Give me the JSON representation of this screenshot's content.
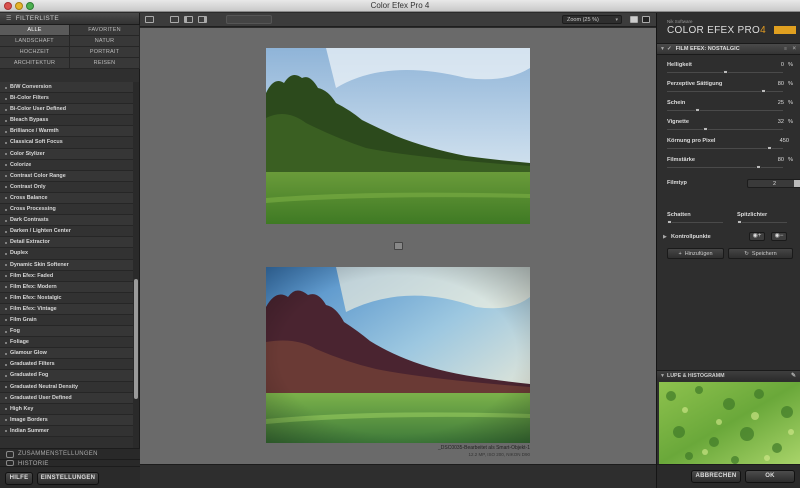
{
  "window": {
    "title": "Color Efex Pro 4"
  },
  "left_panel": {
    "header": "FILTERLISTE",
    "categories": [
      "ALLE",
      "FAVORITEN",
      "LANDSCHAFT",
      "NATUR",
      "HOCHZEIT",
      "PORTRAIT",
      "ARCHITEKTUR",
      "REISEN"
    ],
    "active_category": "ALLE",
    "filters": [
      "B/W Conversion",
      "Bi-Color Filters",
      "Bi-Color User Defined",
      "Bleach Bypass",
      "Brilliance / Warmth",
      "Classical Soft Focus",
      "Color Stylizer",
      "Colorize",
      "Contrast Color Range",
      "Contrast Only",
      "Cross Balance",
      "Cross Processing",
      "Dark Contrasts",
      "Darken / Lighten Center",
      "Detail Extractor",
      "Duplex",
      "Dynamic Skin Softener",
      "Film Efex: Faded",
      "Film Efex: Modern",
      "Film Efex: Nostalgic",
      "Film Efex: Vintage",
      "Film Grain",
      "Fog",
      "Foliage",
      "Glamour Glow",
      "Graduated Filters",
      "Graduated Fog",
      "Graduated Neutral Density",
      "Graduated User Defined",
      "High Key",
      "Image Borders",
      "Indian Summer"
    ],
    "sections": {
      "presets": "ZUSAMMENSTELLUNGEN",
      "history": "HISTORIE"
    },
    "buttons": {
      "help": "HILFE",
      "settings": "EINSTELLUNGEN"
    }
  },
  "toolbar": {
    "zoom": "Zoom (25 %)"
  },
  "canvas": {
    "caption_line1": "_DSC0035-Bearbeitet als Smart-Objekt-1",
    "caption_line2": "12.2 MP, ISO 200, NIKON D90"
  },
  "right_panel": {
    "brand_small": "Nik Software",
    "brand": "COLOR EFEX PRO",
    "brand_version": "4",
    "filter_header": "FILM EFEX: NOSTALGIC",
    "sliders": [
      {
        "label": "Helligkeit",
        "value": "0",
        "unit": "%",
        "fraction": 0.5
      },
      {
        "label": "Perzeptive Sättigung",
        "value": "80",
        "unit": "%",
        "fraction": 0.85
      },
      {
        "label": "Schein",
        "value": "25",
        "unit": "%",
        "fraction": 0.25
      },
      {
        "label": "Vignette",
        "value": "32",
        "unit": "%",
        "fraction": 0.32
      },
      {
        "label": "Körnung pro Pixel",
        "value": "450",
        "unit": "",
        "fraction": 0.9
      },
      {
        "label": "Filmstärke",
        "value": "80",
        "unit": "%",
        "fraction": 0.8
      }
    ],
    "filmtype": {
      "label": "Filmtyp",
      "value": "2"
    },
    "shadows_label": "Schatten",
    "highlights_label": "Spitzlichter",
    "control_points_label": "Kontrollpunkte",
    "add_button": "Hinzufügen",
    "save_button": "Speichern",
    "loupe_header": "LUPE & HISTOGRAMM",
    "buttons": {
      "cancel": "ABBRECHEN",
      "ok": "OK"
    }
  }
}
